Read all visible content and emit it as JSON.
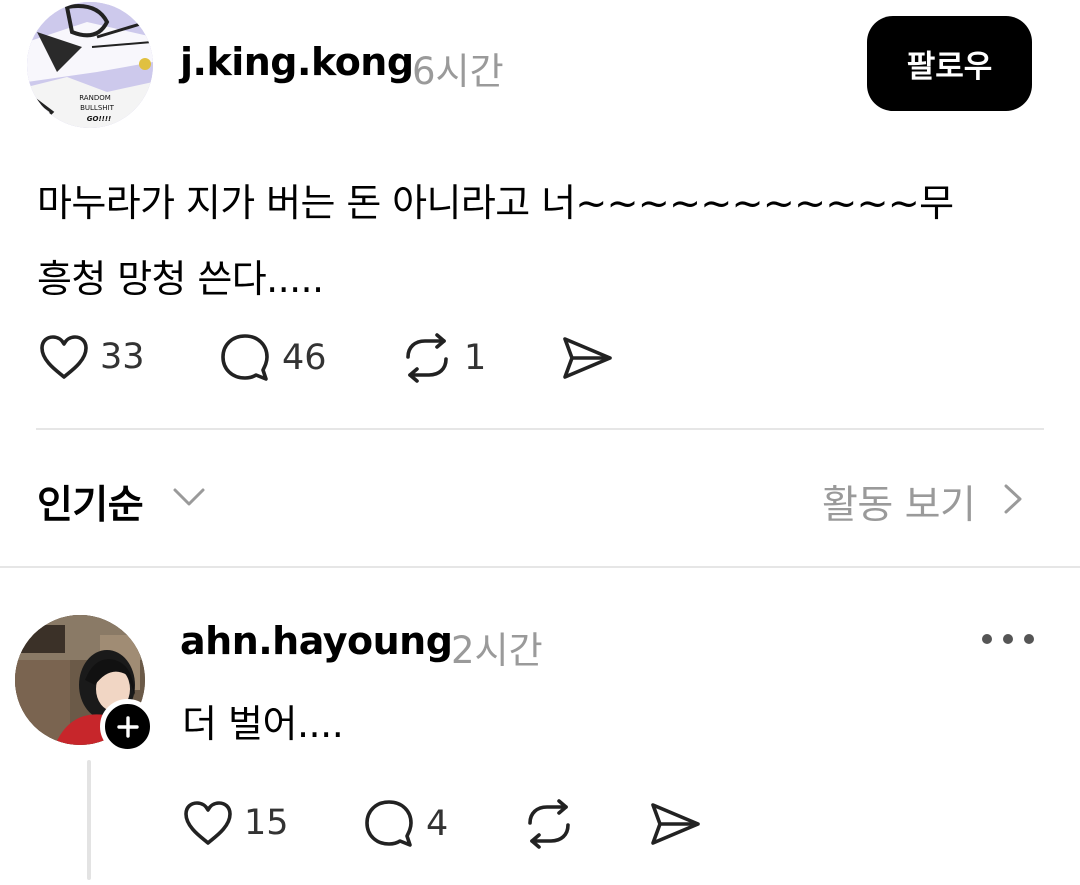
{
  "post": {
    "username": "j.king.kong",
    "time": "6시간",
    "follow_label": "팔로우",
    "avatar_text": [
      "RANDOM",
      "BULLSHIT",
      "GO!!!!"
    ],
    "text": "마누라가 지가 버는 돈 아니라고 너~~~~~~~~~~~무\n흥청 망청 쓴다.....",
    "actions": {
      "likes": "33",
      "comments": "46",
      "reposts": "1"
    }
  },
  "sort": {
    "label": "인기순",
    "activity_label": "활동 보기"
  },
  "reply": {
    "username": "ahn.hayoung",
    "time": "2시간",
    "text": "더 벌어....",
    "actions": {
      "likes": "15",
      "comments": "4"
    }
  },
  "icons": [
    "heart-icon",
    "comment-icon",
    "repost-icon",
    "share-icon",
    "chevron-down-icon",
    "chevron-right-icon",
    "plus-icon",
    "more-icon"
  ],
  "colors": {
    "follow_bg": "#000000",
    "muted_text": "#9a9a9a",
    "divider": "#e6e6e6"
  }
}
